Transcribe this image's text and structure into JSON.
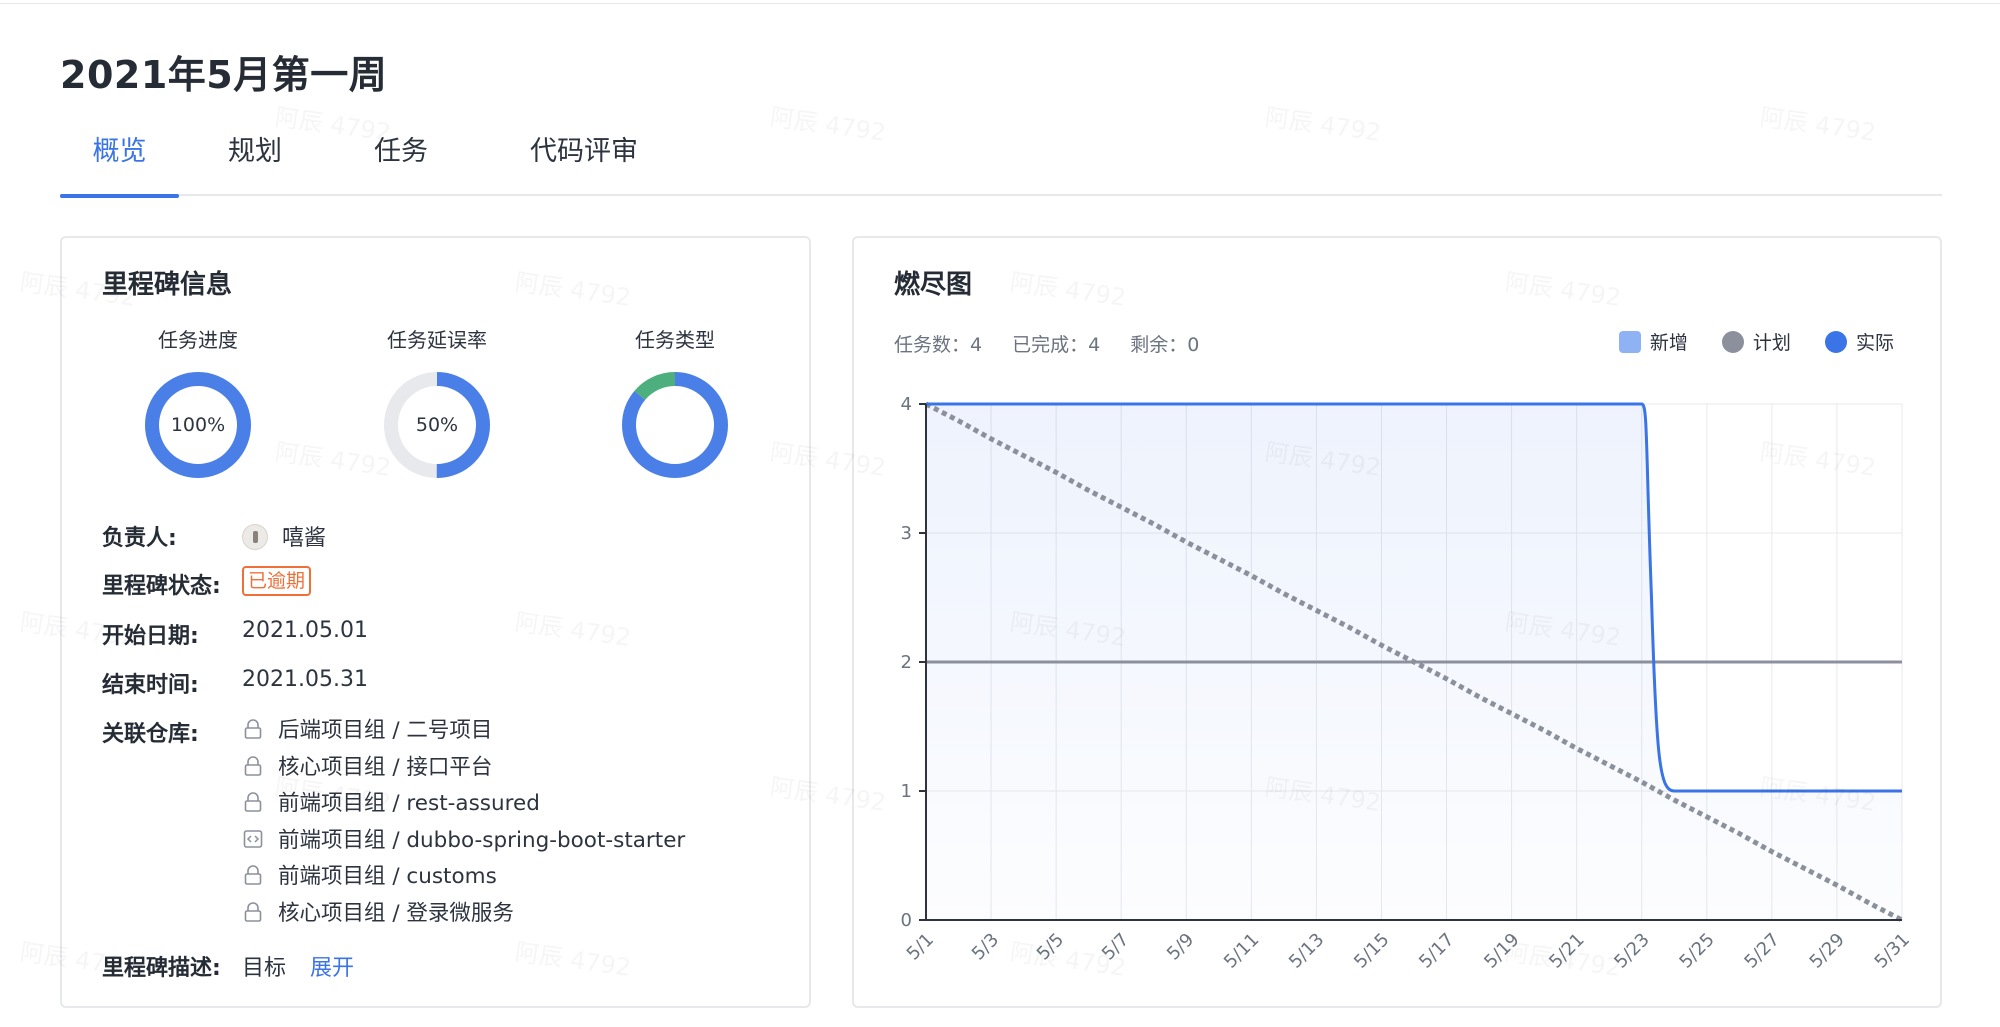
{
  "page": {
    "title": "2021年5月第一周"
  },
  "tabs": [
    {
      "label": "概览",
      "active": true
    },
    {
      "label": "规划",
      "active": false
    },
    {
      "label": "任务",
      "active": false
    },
    {
      "label": "代码评审",
      "active": false
    }
  ],
  "milestone": {
    "title": "里程碑信息",
    "donuts": [
      {
        "label": "任务进度",
        "percent": 100,
        "text": "100%"
      },
      {
        "label": "任务延误率",
        "percent": 50,
        "text": "50%"
      },
      {
        "label": "任务类型",
        "segments": [
          {
            "fraction": 0.86,
            "color": "#4a7fe8"
          },
          {
            "fraction": 0.14,
            "color": "#4caf7d"
          }
        ]
      }
    ],
    "owner_label": "负责人:",
    "owner_name": "嘻酱",
    "status_label": "里程碑状态:",
    "status_badge": "已逾期",
    "start_label": "开始日期:",
    "start_date": "2021.05.01",
    "end_label": "结束时间:",
    "end_date": "2021.05.31",
    "repos_label": "关联仓库:",
    "repos": [
      {
        "name": "后端项目组 / 二号项目",
        "icon": "lock-icon"
      },
      {
        "name": "核心项目组 / 接口平台",
        "icon": "lock-icon"
      },
      {
        "name": "前端项目组 / rest-assured",
        "icon": "lock-icon"
      },
      {
        "name": "前端项目组 / dubbo-spring-boot-starter",
        "icon": "code-icon"
      },
      {
        "name": "前端项目组 / customs",
        "icon": "lock-icon"
      },
      {
        "name": "核心项目组 / 登录微服务",
        "icon": "lock-icon"
      }
    ],
    "desc_label": "里程碑描述:",
    "desc_text": "目标",
    "expand_link": "展开"
  },
  "burndown": {
    "title": "燃尽图",
    "stats": {
      "total": "任务数：4",
      "done": "已完成：4",
      "remaining": "剩余：0"
    },
    "legend": [
      {
        "label": "新增",
        "color": "#8fb2f5",
        "shape": "square"
      },
      {
        "label": "计划",
        "color": "#8b909c",
        "shape": "circle"
      },
      {
        "label": "实际",
        "color": "#3b74e6",
        "shape": "circle"
      }
    ]
  },
  "chart_data": {
    "type": "line",
    "title": "燃尽图",
    "x": [
      "5/1",
      "5/2",
      "5/3",
      "5/4",
      "5/5",
      "5/6",
      "5/7",
      "5/8",
      "5/9",
      "5/10",
      "5/11",
      "5/12",
      "5/13",
      "5/14",
      "5/15",
      "5/16",
      "5/17",
      "5/18",
      "5/19",
      "5/20",
      "5/21",
      "5/22",
      "5/23",
      "5/24",
      "5/25",
      "5/26",
      "5/27",
      "5/28",
      "5/29",
      "5/30",
      "5/31"
    ],
    "xticks": [
      "5/1",
      "5/3",
      "5/5",
      "5/7",
      "5/9",
      "5/11",
      "5/13",
      "5/15",
      "5/17",
      "5/19",
      "5/21",
      "5/23",
      "5/25",
      "5/27",
      "5/29",
      "5/31"
    ],
    "ylim": [
      0,
      4
    ],
    "yticks": [
      0,
      1,
      2,
      3,
      4
    ],
    "grid": true,
    "legend_position": "top-right",
    "series": [
      {
        "name": "新增",
        "style": "line",
        "color": "#3b74e6",
        "values": [
          4,
          4,
          4,
          4,
          4,
          4,
          4,
          4,
          4,
          4,
          4,
          4,
          4,
          4,
          4,
          4,
          4,
          4,
          4,
          4,
          4,
          4,
          4,
          1,
          1,
          1,
          1,
          1,
          1,
          1,
          1
        ],
        "fill": true
      },
      {
        "name": "计划",
        "style": "dotted",
        "color": "#8b909c",
        "values": [
          4,
          3.87,
          3.73,
          3.6,
          3.47,
          3.33,
          3.2,
          3.07,
          2.93,
          2.8,
          2.67,
          2.53,
          2.4,
          2.27,
          2.13,
          2,
          1.87,
          1.73,
          1.6,
          1.47,
          1.33,
          1.2,
          1.07,
          0.93,
          0.8,
          0.67,
          0.53,
          0.4,
          0.27,
          0.13,
          0
        ]
      },
      {
        "name": "实际",
        "style": "line",
        "color": "#8b909c",
        "values": [
          2,
          2,
          2,
          2,
          2,
          2,
          2,
          2,
          2,
          2,
          2,
          2,
          2,
          2,
          2,
          2,
          2,
          2,
          2,
          2,
          2,
          2,
          2,
          2,
          2,
          2,
          2,
          2,
          2,
          2,
          2
        ]
      }
    ]
  },
  "watermark": "阿辰 4792",
  "colors": {
    "accent": "#3b74e6",
    "danger": "#f0703a",
    "green": "#4caf7d"
  }
}
